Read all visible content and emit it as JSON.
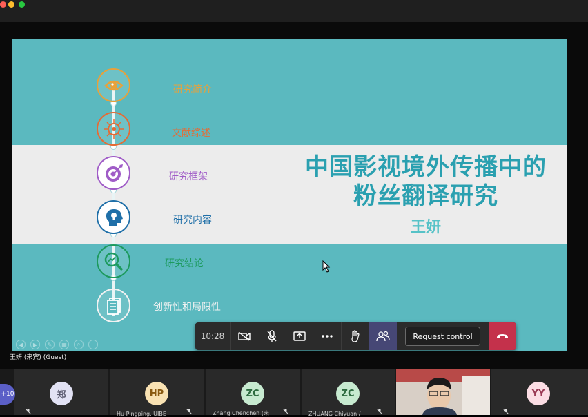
{
  "window": {
    "dots": [
      "#ff5f57",
      "#febc2e",
      "#28c840"
    ]
  },
  "slide": {
    "title_line1": "中国影视境外传播中的",
    "title_line2": "粉丝翻译研究",
    "author": "王妍",
    "items": [
      {
        "label": "研究简介",
        "color": "#e8a13a",
        "icon": "eye-icon"
      },
      {
        "label": "文献综述",
        "color": "#e56b34",
        "icon": "network-brain-icon"
      },
      {
        "label": "研究框架",
        "color": "#a05cc7",
        "icon": "target-icon"
      },
      {
        "label": "研究内容",
        "color": "#1f6fa8",
        "icon": "head-lightbulb-icon"
      },
      {
        "label": "研究结论",
        "color": "#1d9a5e",
        "icon": "magnifier-chart-icon"
      },
      {
        "label": "创新性和局限性",
        "color": "#f2f2f2",
        "icon": "document-icon"
      }
    ]
  },
  "toolbar": {
    "time": "10:28",
    "request_control": "Request control"
  },
  "presenter": {
    "name": "王妍 (来宾) (Guest)"
  },
  "participants": {
    "more_count": "+10",
    "tiles": [
      {
        "initials": "郑",
        "name": "",
        "avatar_color": "#e2e2f4"
      },
      {
        "initials": "HP",
        "name": "Hu Pingping, UIBE",
        "avatar_color": "#f9e2b3"
      },
      {
        "initials": "ZC",
        "name": "Zhang Chenchen (未",
        "avatar_color": "#c7ead0"
      },
      {
        "initials": "ZC",
        "name": "ZHUANG Chiyuan /",
        "avatar_color": "#c7ead0"
      },
      {
        "initials": "",
        "name": "",
        "avatar_color": ""
      },
      {
        "initials": "YY",
        "name": "",
        "avatar_color": "#fbdde4"
      }
    ]
  }
}
